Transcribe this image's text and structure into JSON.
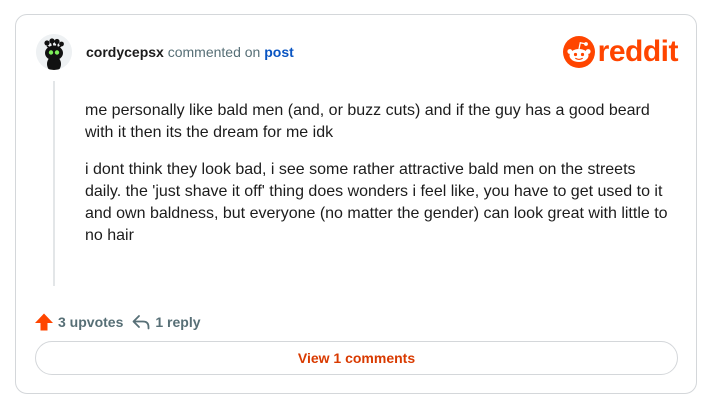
{
  "comment": {
    "username": "cordycepsx",
    "action_text": " commented on ",
    "post_link": "post",
    "paragraphs": [
      "me personally like bald men (and, or buzz cuts) and if the guy has a good beard with it then its the dream for me idk",
      "i dont think they look bad, i see some rather attractive bald men on the streets daily. the 'just shave it off' thing does wonders i feel like, you have to get used to it and own baldness, but everyone (no matter the gender) can look great with little to no hair"
    ],
    "upvotes_label": "3 upvotes",
    "reply_label": "1 reply"
  },
  "brand": {
    "wordmark": "reddit",
    "color": "#ff4500"
  },
  "footer": {
    "view_comments_label": "View 1 comments"
  },
  "icons": {
    "upvote": "upvote-arrow-icon",
    "reply": "reply-arrow-icon",
    "logo": "reddit-snoo-icon"
  }
}
